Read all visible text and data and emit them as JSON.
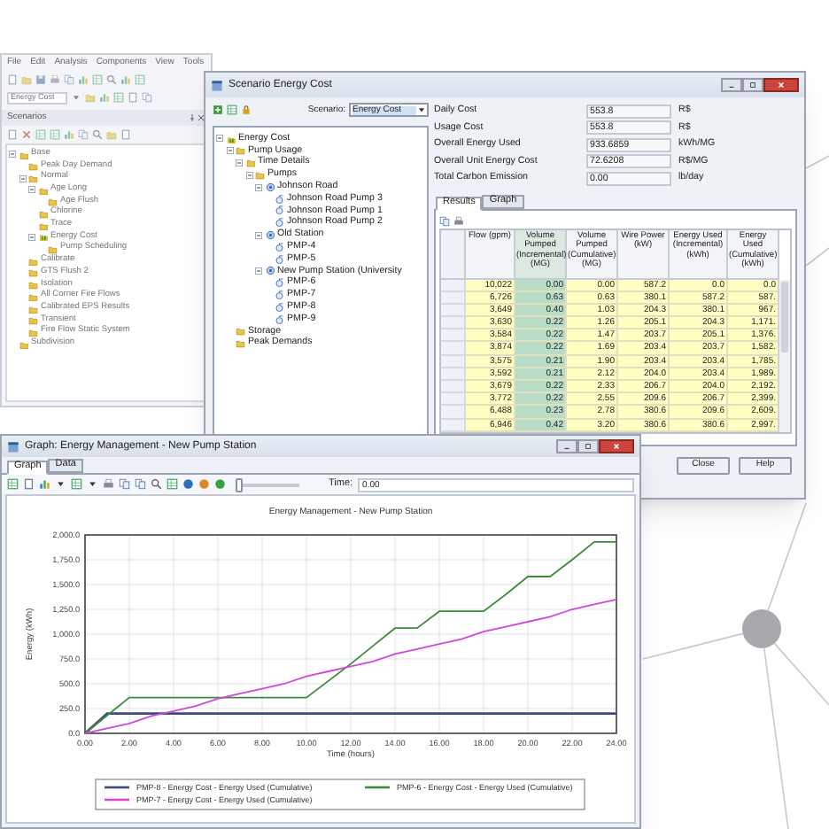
{
  "background_app": {
    "menu": [
      "File",
      "Edit",
      "Analysis",
      "Components",
      "View",
      "Tools"
    ],
    "scenario_dropdown": "Energy Cost",
    "panel_title": "Scenarios",
    "tree": [
      {
        "label": "Base",
        "kind": "folder",
        "expanded": true,
        "children": [
          {
            "label": "Peak Day Demand",
            "kind": "folder"
          },
          {
            "label": "Normal",
            "kind": "folder",
            "expanded": true,
            "children": [
              {
                "label": "Age Long",
                "kind": "folder",
                "expanded": true,
                "children": [
                  {
                    "label": "Age Flush",
                    "kind": "folder"
                  }
                ]
              },
              {
                "label": "Chlorine",
                "kind": "folder"
              },
              {
                "label": "Trace",
                "kind": "folder"
              },
              {
                "label": "Energy Cost",
                "kind": "root",
                "expanded": true,
                "children": [
                  {
                    "label": "Pump Scheduling",
                    "kind": "folder"
                  }
                ]
              }
            ]
          },
          {
            "label": "Calibrate",
            "kind": "folder"
          },
          {
            "label": "GTS Flush 2",
            "kind": "folder"
          },
          {
            "label": "Isolation",
            "kind": "folder"
          },
          {
            "label": "All Corner Fire Flows",
            "kind": "folder"
          },
          {
            "label": "Calibrated EPS Results",
            "kind": "folder"
          },
          {
            "label": "Transient",
            "kind": "folder"
          },
          {
            "label": "Fire Flow Static System",
            "kind": "folder"
          }
        ]
      },
      {
        "label": "Subdivision",
        "kind": "folder"
      }
    ]
  },
  "scenario_window": {
    "title": "Scenario Energy Cost",
    "scenario_label": "Scenario:",
    "scenario_value": "Energy Cost",
    "tree": [
      {
        "label": "Energy Cost",
        "kind": "root",
        "expanded": true,
        "children": [
          {
            "label": "Pump Usage",
            "kind": "folder",
            "expanded": true,
            "children": [
              {
                "label": "Time Details",
                "kind": "folder",
                "expanded": true,
                "children": [
                  {
                    "label": "Pumps",
                    "kind": "folder",
                    "expanded": true,
                    "children": [
                      {
                        "label": "Johnson Road",
                        "kind": "station",
                        "expanded": true,
                        "children": [
                          {
                            "label": "Johnson Road Pump 3",
                            "kind": "pump"
                          },
                          {
                            "label": "Johnson Road Pump 1",
                            "kind": "pump"
                          },
                          {
                            "label": "Johnson Road Pump 2",
                            "kind": "pump"
                          }
                        ]
                      },
                      {
                        "label": "Old Station",
                        "kind": "station",
                        "expanded": true,
                        "children": [
                          {
                            "label": "PMP-4",
                            "kind": "pump"
                          },
                          {
                            "label": "PMP-5",
                            "kind": "pump"
                          }
                        ]
                      },
                      {
                        "label": "New Pump Station (University",
                        "kind": "station",
                        "expanded": true,
                        "children": [
                          {
                            "label": "PMP-6",
                            "kind": "pump"
                          },
                          {
                            "label": "PMP-7",
                            "kind": "pump"
                          },
                          {
                            "label": "PMP-8",
                            "kind": "pump"
                          },
                          {
                            "label": "PMP-9",
                            "kind": "pump"
                          }
                        ]
                      }
                    ]
                  }
                ]
              }
            ]
          },
          {
            "label": "Storage",
            "kind": "folder"
          },
          {
            "label": "Peak Demands",
            "kind": "folder"
          }
        ]
      }
    ],
    "summary": [
      {
        "label": "Daily Cost",
        "value": "553.8",
        "unit": "R$"
      },
      {
        "label": "Usage Cost",
        "value": "553.8",
        "unit": "R$"
      },
      {
        "label": "Overall Energy Used",
        "value": "933.6859",
        "unit": "kWh/MG"
      },
      {
        "label": "Overall Unit Energy Cost",
        "value": "72.6208",
        "unit": "R$/MG"
      },
      {
        "label": "Total Carbon Emission",
        "value": "0.00",
        "unit": "lb/day"
      }
    ],
    "tabs": [
      {
        "label": "Results",
        "selected": true
      },
      {
        "label": "Graph",
        "selected": false
      }
    ],
    "table": {
      "columns": [
        {
          "label": "Flow (gpm)",
          "selected": false
        },
        {
          "label": "Volume Pumped (Incremental) (MG)",
          "selected": true
        },
        {
          "label": "Volume Pumped (Cumulative) (MG)",
          "selected": false
        },
        {
          "label": "Wire Power (kW)",
          "selected": false
        },
        {
          "label": "Energy Used (Incremental) (kWh)",
          "selected": false
        },
        {
          "label": "Energy Used (Cumulative) (kWh)",
          "selected": false
        }
      ],
      "rows": [
        [
          "10,022",
          "0.00",
          "0.00",
          "587.2",
          "0.0",
          "0.0"
        ],
        [
          "6,726",
          "0.63",
          "0.63",
          "380.1",
          "587.2",
          "587."
        ],
        [
          "3,649",
          "0.40",
          "1.03",
          "204.3",
          "380.1",
          "967."
        ],
        [
          "3,630",
          "0.22",
          "1.26",
          "205.1",
          "204.3",
          "1,171."
        ],
        [
          "3,584",
          "0.22",
          "1.47",
          "203.7",
          "205.1",
          "1,376."
        ],
        [
          "3,874",
          "0.22",
          "1.69",
          "203.4",
          "203.7",
          "1,582."
        ],
        [
          "3,575",
          "0.21",
          "1.90",
          "203.4",
          "203.4",
          "1,785."
        ],
        [
          "3,592",
          "0.21",
          "2.12",
          "204.0",
          "203.4",
          "1,989."
        ],
        [
          "3,679",
          "0.22",
          "2.33",
          "206.7",
          "204.0",
          "2,192."
        ],
        [
          "3,772",
          "0.22",
          "2.55",
          "209.6",
          "206.7",
          "2,399."
        ],
        [
          "6,488",
          "0.23",
          "2.78",
          "380.6",
          "209.6",
          "2,609."
        ],
        [
          "6,946",
          "0.42",
          "3.20",
          "380.6",
          "380.6",
          "2,997."
        ]
      ]
    },
    "buttons": [
      "Close",
      "Help"
    ]
  },
  "graph_window": {
    "title": "Graph: Energy Management - New Pump Station",
    "tabs": [
      {
        "label": "Graph",
        "selected": true
      },
      {
        "label": "Data",
        "selected": false
      }
    ],
    "slider": {
      "level": 0
    },
    "time_label": "Time:",
    "time_value": "0.00",
    "chart_data": {
      "type": "line",
      "title": "Energy Management - New Pump Station",
      "xlabel": "Time (hours)",
      "ylabel": "Energy (kWh)",
      "x": [
        0,
        1,
        2,
        3,
        4,
        5,
        6,
        7,
        8,
        9,
        10,
        11,
        12,
        13,
        14,
        15,
        16,
        17,
        18,
        19,
        20,
        21,
        22,
        23,
        24
      ],
      "series": [
        {
          "name": "PMP-8 - Energy Cost - Energy Used (Cumulative)",
          "color": "#3b4a80",
          "values": [
            0,
            200,
            200,
            200,
            200,
            200,
            200,
            200,
            200,
            200,
            200,
            200,
            200,
            200,
            200,
            200,
            200,
            200,
            200,
            200,
            200,
            200,
            200,
            200,
            200
          ]
        },
        {
          "name": "PMP-6 - Energy Cost - Energy Used (Cumulative)",
          "color": "#3a8c3a",
          "values": [
            0,
            180,
            360,
            360,
            360,
            360,
            360,
            360,
            360,
            360,
            360,
            530,
            700,
            880,
            1060,
            1060,
            1230,
            1230,
            1230,
            1400,
            1580,
            1580,
            1750,
            1930,
            1930
          ]
        },
        {
          "name": "PMP-7 - Energy Cost - Energy Used (Cumulative)",
          "color": "#d048d8",
          "values": [
            0,
            50,
            100,
            175,
            225,
            275,
            350,
            400,
            450,
            500,
            575,
            625,
            675,
            725,
            800,
            850,
            900,
            950,
            1025,
            1075,
            1125,
            1175,
            1250,
            1300,
            1350
          ]
        }
      ],
      "grid": true,
      "legend": "bottom",
      "xlim": [
        0,
        24
      ],
      "ylim": [
        0,
        2000
      ],
      "xticks": [
        {
          "value": 0,
          "label": "0.00"
        },
        {
          "value": 2,
          "label": "2.00"
        },
        {
          "value": 4,
          "label": "4.00"
        },
        {
          "value": 6,
          "label": "6.00"
        },
        {
          "value": 8,
          "label": "8.00"
        },
        {
          "value": 10,
          "label": "10.00"
        },
        {
          "value": 12,
          "label": "12.00"
        },
        {
          "value": 14,
          "label": "14.00"
        },
        {
          "value": 16,
          "label": "16.00"
        },
        {
          "value": 18,
          "label": "18.00"
        },
        {
          "value": 20,
          "label": "20.00"
        },
        {
          "value": 22,
          "label": "22.00"
        },
        {
          "value": 24,
          "label": "24.00"
        }
      ],
      "yticks": [
        {
          "value": 0,
          "label": "0.0"
        },
        {
          "value": 250,
          "label": "250.0"
        },
        {
          "value": 500,
          "label": "500.0"
        },
        {
          "value": 750,
          "label": "750.0"
        },
        {
          "value": 1000,
          "label": "1,000.0"
        },
        {
          "value": 1250,
          "label": "1,250.0"
        },
        {
          "value": 1500,
          "label": "1,500.0"
        },
        {
          "value": 1750,
          "label": "1,750.0"
        },
        {
          "value": 2000,
          "label": "2,000.0"
        }
      ]
    }
  }
}
